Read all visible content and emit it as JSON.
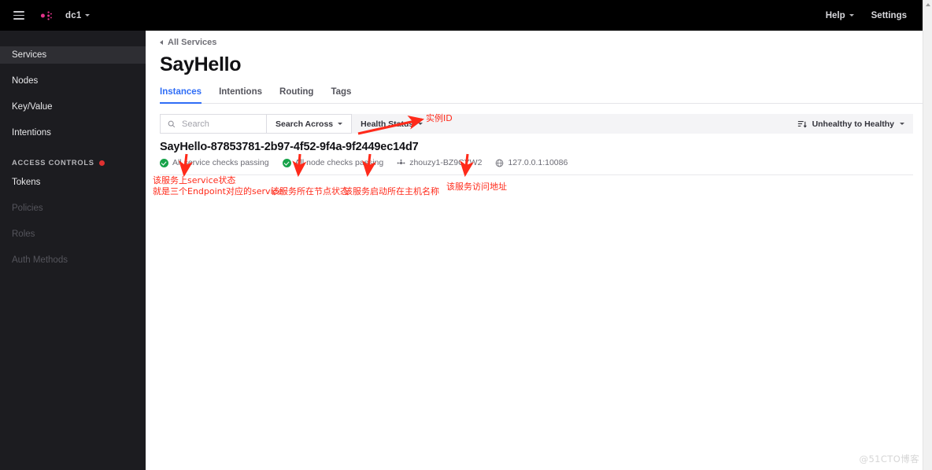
{
  "topbar": {
    "menu_icon": "hamburger-icon",
    "logo_icon": "consul-logo-icon",
    "datacenter": "dc1",
    "help_label": "Help",
    "settings_label": "Settings"
  },
  "sidebar": {
    "items": [
      {
        "label": "Services",
        "state": "active"
      },
      {
        "label": "Nodes",
        "state": "normal"
      },
      {
        "label": "Key/Value",
        "state": "normal"
      },
      {
        "label": "Intentions",
        "state": "normal"
      }
    ],
    "section_label": "ACCESS CONTROLS",
    "section_badge": "red-dot",
    "acl_items": [
      {
        "label": "Tokens",
        "state": "normal"
      },
      {
        "label": "Policies",
        "state": "disabled"
      },
      {
        "label": "Roles",
        "state": "disabled"
      },
      {
        "label": "Auth Methods",
        "state": "disabled"
      }
    ]
  },
  "main": {
    "breadcrumb": "All Services",
    "title": "SayHello",
    "tabs": [
      {
        "label": "Instances",
        "active": true
      },
      {
        "label": "Intentions",
        "active": false
      },
      {
        "label": "Routing",
        "active": false
      },
      {
        "label": "Tags",
        "active": false
      }
    ],
    "filters": {
      "search_placeholder": "Search",
      "search_value": "",
      "search_across_label": "Search Across",
      "health_status_label": "Health Status",
      "sort_label": "Unhealthy to Healthy"
    },
    "instance": {
      "id": "SayHello-87853781-2b97-4f52-9f4a-9f2449ec14d7",
      "service_checks": "All service checks passing",
      "node_checks": "All node checks passing",
      "node_name": "zhouzy1-BZ9CYW2",
      "address": "127.0.0.1:10086"
    }
  },
  "annotations": {
    "instance_id": "实例ID",
    "service_status_line1": "该服务上service状态",
    "service_status_line2": "就是三个Endpoint对应的service",
    "node_status": "该服务所在节点状态",
    "host_name": "该服务启动所在主机名称",
    "address": "该服务访问地址"
  },
  "watermark": "@51CTO博客",
  "colors": {
    "accent_blue": "#2f6df6",
    "consul_pink": "#e0338a",
    "healthy_green": "#17a34a",
    "annotation_red": "#ff2a1a",
    "topbar_black": "#000000",
    "sidebar_dark": "#1c1c20"
  }
}
